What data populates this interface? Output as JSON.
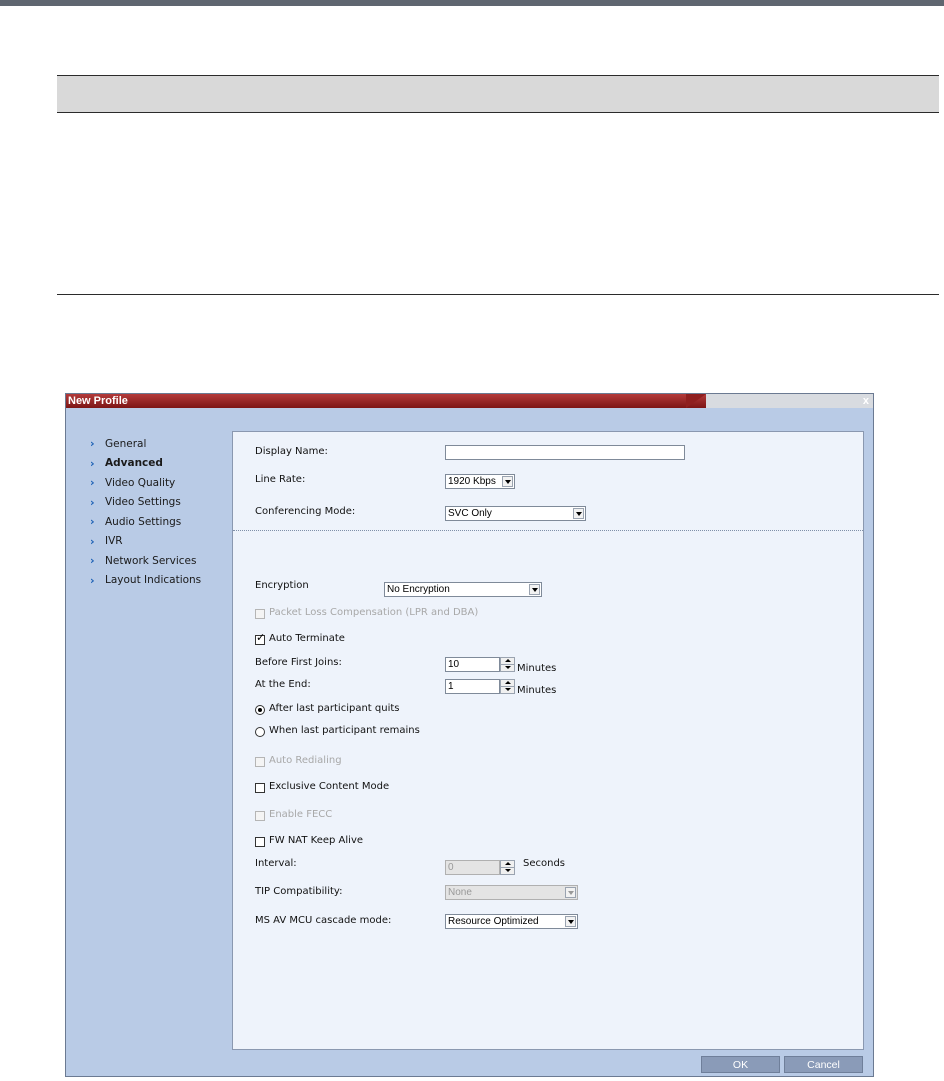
{
  "dialog": {
    "title": "New Profile",
    "close_glyph": "x"
  },
  "nav": {
    "items": [
      {
        "label": "General"
      },
      {
        "label": "Advanced"
      },
      {
        "label": "Video Quality"
      },
      {
        "label": "Video Settings"
      },
      {
        "label": "Audio Settings"
      },
      {
        "label": "IVR"
      },
      {
        "label": "Network Services"
      },
      {
        "label": "Layout Indications"
      }
    ],
    "active": "Advanced"
  },
  "form": {
    "display_name_label": "Display Name:",
    "display_name_value": "",
    "line_rate_label": "Line Rate:",
    "line_rate_value": "1920 Kbps",
    "conf_mode_label": "Conferencing Mode:",
    "conf_mode_value": "SVC Only",
    "encryption_label": "Encryption",
    "encryption_value": "No Encryption",
    "plc_label": "Packet Loss Compensation (LPR and DBA)",
    "auto_terminate_label": "Auto Terminate",
    "before_first_label": "Before First Joins:",
    "before_first_value": "10",
    "minutes_label": "Minutes",
    "at_end_label": "At the End:",
    "at_end_value": "1",
    "after_last_quits_label": "After last participant quits",
    "when_last_remains_label": "When last participant remains",
    "auto_redialing_label": "Auto Redialing",
    "exclusive_content_label": "Exclusive Content Mode",
    "enable_fecc_label": "Enable FECC",
    "fw_nat_label": "FW NAT Keep Alive",
    "interval_label": "Interval:",
    "interval_value": "0",
    "seconds_label": "Seconds",
    "tip_label": "TIP Compatibility:",
    "tip_value": "None",
    "ms_av_label": "MS AV MCU cascade mode:",
    "ms_av_value": "Resource Optimized"
  },
  "state": {
    "auto_terminate_checked": true,
    "after_last_quits_selected": true
  },
  "buttons": {
    "ok": "OK",
    "cancel": "Cancel"
  },
  "colors": {
    "dialog_bg": "#b9cbe6",
    "panel_bg": "#eef3fb",
    "title_red": "#9c2424",
    "nav_chevron": "#1a5fb4",
    "button_bg": "#8a9bb8"
  }
}
